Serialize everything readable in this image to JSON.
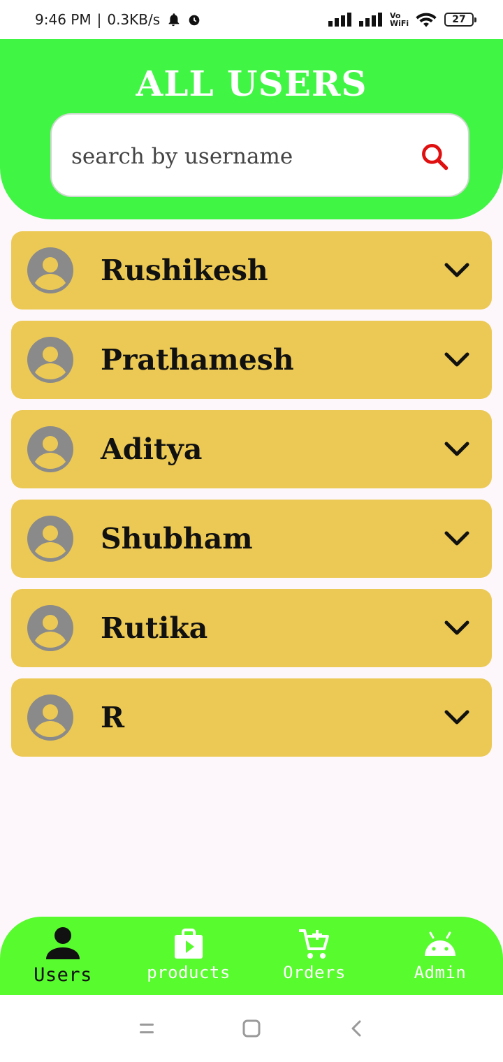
{
  "status_bar": {
    "time": "9:46 PM",
    "speed": "0.3KB/s",
    "network_type": "Vo WiFi",
    "battery": "27"
  },
  "header": {
    "title": "ALL USERS",
    "search_placeholder": "search by username"
  },
  "users": [
    {
      "name": "Rushikesh"
    },
    {
      "name": "Prathamesh"
    },
    {
      "name": "Aditya"
    },
    {
      "name": "Shubham"
    },
    {
      "name": "Rutika"
    },
    {
      "name": "R"
    }
  ],
  "bottom_nav": {
    "active": "users",
    "items": [
      {
        "key": "users",
        "label": "Users",
        "icon": "person-icon"
      },
      {
        "key": "products",
        "label": "products",
        "icon": "shopping-bag-play-icon"
      },
      {
        "key": "orders",
        "label": "Orders",
        "icon": "add-to-cart-icon"
      },
      {
        "key": "admin",
        "label": "Admin",
        "icon": "android-icon"
      }
    ]
  },
  "colors": {
    "header_green": "#41f545",
    "nav_green": "#58fb2e",
    "card_yellow": "#ecc954",
    "search_icon_red": "#e01010",
    "avatar_grey": "#8a8a8a"
  }
}
